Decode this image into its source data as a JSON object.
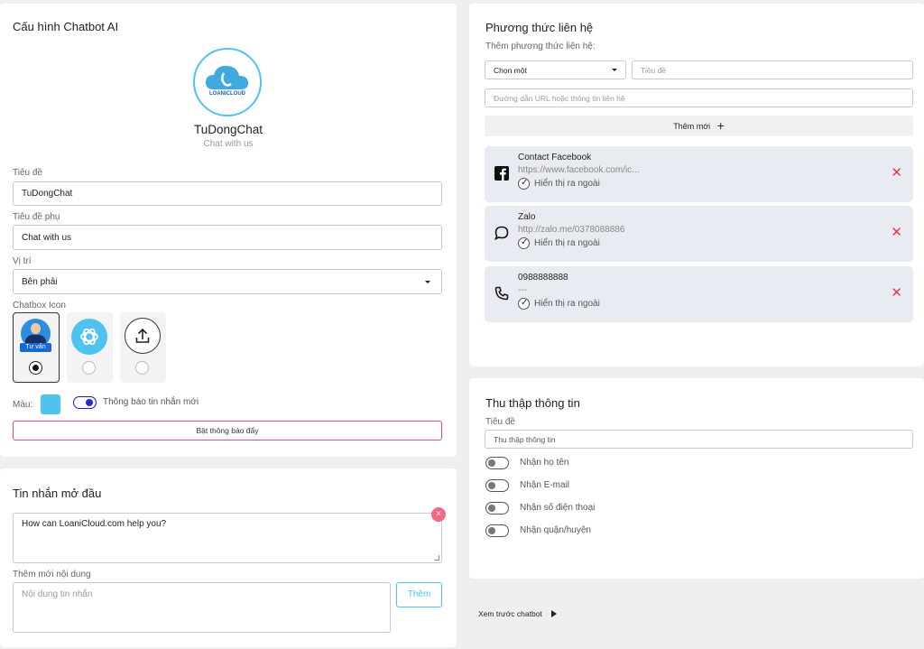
{
  "config": {
    "title": "Cấu hình Chatbot AI",
    "logo_text": "LOANICLOUD",
    "bot_name": "TuDongChat",
    "bot_subtitle": "Chat with us",
    "title_label": "Tiêu đề",
    "title_value": "TuDongChat",
    "subtitle_label": "Tiêu đề phụ",
    "subtitle_value": "Chat with us",
    "position_label": "Vị trí",
    "position_value": "Bên phải",
    "icon_label": "Chatbox Icon",
    "icon_avatar_caption": "Tư vấn",
    "color_label": "Màu:",
    "accent_color": "#4ec3f0",
    "notify_label": "Thông báo tin nhắn mới",
    "push_button": "Bật thông báo đẩy"
  },
  "opening": {
    "title": "Tin nhắn mở đầu",
    "message": "How can LoaniCloud.com help you?",
    "add_label": "Thêm mới nội dung",
    "add_placeholder": "Nội dung tin nhắn",
    "add_button": "Thêm"
  },
  "contact": {
    "title": "Phương thức liên hệ",
    "add_label": "Thêm phương thức liên hệ:",
    "select_value": "Chọn một",
    "title_placeholder": "Tiêu đề",
    "url_placeholder": "Đường dẫn URL hoặc thông tin liên hệ",
    "add_button": "Thêm mới",
    "items": [
      {
        "name": "Contact Facebook",
        "value": "https://www.facebook.com/ic...",
        "show": "Hiển thị ra ngoài",
        "icon": "facebook-icon"
      },
      {
        "name": "Zalo",
        "value": "http://zalo.me/0378088886",
        "show": "Hiển thị ra ngoài",
        "icon": "chat-bubble-icon"
      },
      {
        "name": "0988888888",
        "value": "---",
        "show": "Hiển thị ra ngoài",
        "icon": "phone-icon"
      }
    ]
  },
  "collect": {
    "title": "Thu thập thông tin",
    "title_label": "Tiêu đề",
    "title_value": "Thu thập thông tin",
    "toggles": [
      "Nhận họ tên",
      "Nhận E-mail",
      "Nhận số điện thoại",
      "Nhận quận/huyện"
    ]
  },
  "preview": {
    "label": "Xem trước chatbot"
  }
}
